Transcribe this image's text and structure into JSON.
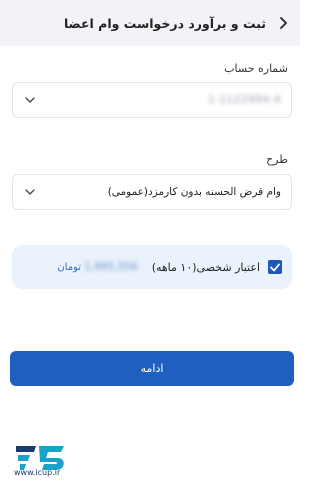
{
  "header": {
    "title": "ثبت و برآورد درخواست وام اعضا",
    "back_icon": "chevron-right-icon"
  },
  "account": {
    "label": "شماره حساب",
    "value": "1-1122994-4",
    "dropdown_icon": "chevron-down-icon"
  },
  "plan": {
    "label": "طرح",
    "value": "وام قرض الحسنه بدون کارمزد(عمومی)",
    "dropdown_icon": "chevron-down-icon"
  },
  "credit": {
    "checked": true,
    "label": "اعتبار شخصی(۱۰ ماهه)",
    "amount": "1,995,556",
    "currency": "تومان"
  },
  "actions": {
    "continue_label": "ادامه"
  },
  "brand": {
    "url": "www.icup.ir",
    "logo_color": "#1aa3c8",
    "primary_color": "#1f5fbf"
  }
}
